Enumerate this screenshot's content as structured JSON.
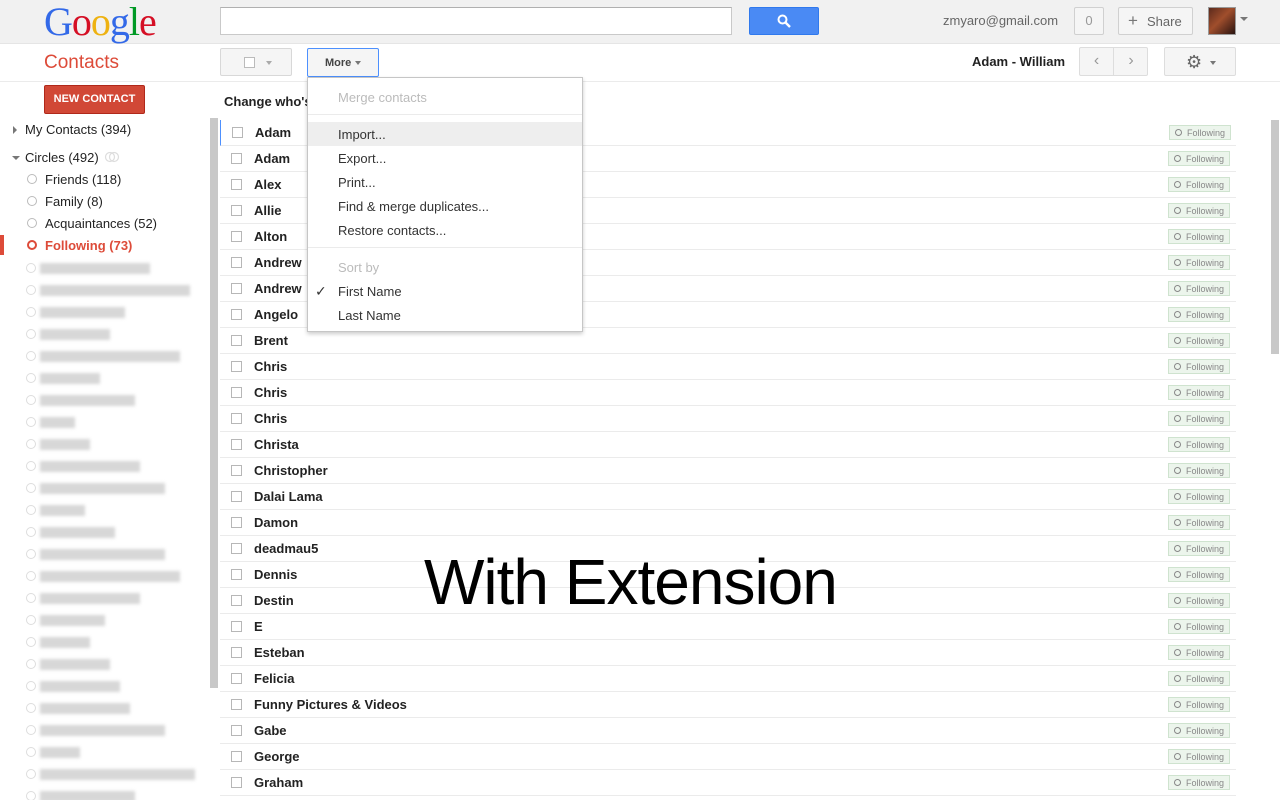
{
  "topbar": {
    "logo_letters": [
      {
        "ch": "G",
        "color": "#3369e8"
      },
      {
        "ch": "o",
        "color": "#d50f25"
      },
      {
        "ch": "o",
        "color": "#eeb211"
      },
      {
        "ch": "g",
        "color": "#3369e8"
      },
      {
        "ch": "l",
        "color": "#009925"
      },
      {
        "ch": "e",
        "color": "#d50f25"
      }
    ],
    "search_value": "",
    "email": "zmyaro@gmail.com",
    "notification_count": "0",
    "share_label": "Share"
  },
  "app_title": "Contacts",
  "toolbar": {
    "more_label": "More",
    "range_label": "Adam - William",
    "prev_icon": "‹",
    "next_icon": "›"
  },
  "sidebar": {
    "new_contact_label": "NEW CONTACT",
    "my_contacts": "My Contacts (394)",
    "circles": "Circles (492)",
    "circle_items": [
      {
        "label": "Friends (118)"
      },
      {
        "label": "Family (8)"
      },
      {
        "label": "Acquaintances (52)"
      },
      {
        "label": "Following (73)"
      }
    ]
  },
  "list": {
    "header": "Change who's",
    "tag_label": "Following",
    "contacts": [
      "Adam",
      "Adam",
      "Alex",
      "Allie",
      "Alton",
      "Andrew",
      "Andrew",
      "Angelo",
      "Brent",
      "Chris",
      "Chris",
      "Chris",
      "Christa",
      "Christopher",
      "Dalai Lama",
      "Damon",
      "deadmau5",
      "Dennis",
      "Destin",
      "E",
      "Esteban",
      "Felicia",
      "Funny Pictures & Videos",
      "Gabe",
      "George",
      "Graham"
    ]
  },
  "menu": {
    "merge": "Merge contacts",
    "import": "Import...",
    "export": "Export...",
    "print": "Print...",
    "find_merge": "Find & merge duplicates...",
    "restore": "Restore contacts...",
    "sort_by": "Sort by",
    "first_name": "First Name",
    "last_name": "Last Name"
  },
  "overlay_text": "With Extension",
  "colors": {
    "accent_red": "#dd4b39",
    "search_blue": "#4a8af4",
    "focus_blue": "#4d90fe"
  }
}
